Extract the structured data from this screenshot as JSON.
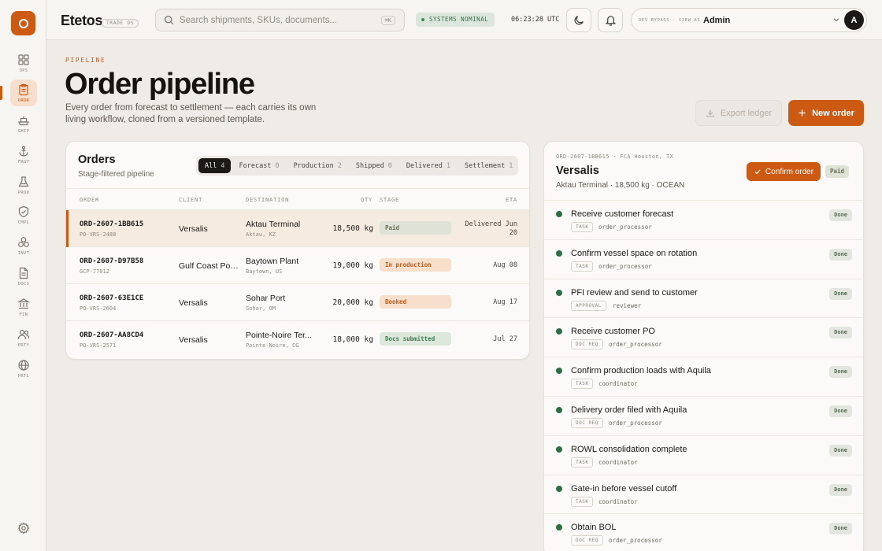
{
  "sidebar": {
    "items": [
      {
        "label": "OPS",
        "icon": "grid-icon"
      },
      {
        "label": "ORDR",
        "icon": "clipboard-icon"
      },
      {
        "label": "SHIP",
        "icon": "ship-icon"
      },
      {
        "label": "FRGT",
        "icon": "anchor-icon"
      },
      {
        "label": "PROD",
        "icon": "flask-icon"
      },
      {
        "label": "CMPL",
        "icon": "shield-check-icon"
      },
      {
        "label": "INVT",
        "icon": "boxes-icon"
      },
      {
        "label": "DOCS",
        "icon": "document-icon"
      },
      {
        "label": "FIN",
        "icon": "bank-icon"
      },
      {
        "label": "PRTY",
        "icon": "users-icon"
      },
      {
        "label": "PRTL",
        "icon": "globe-icon"
      }
    ],
    "active_index": 1
  },
  "header": {
    "brand": "Etetos",
    "brand_badge": "TRADE OS",
    "search_placeholder": "Search shipments, SKUs, documents...",
    "search_shortcut": "⌘K",
    "status": "SYSTEMS NOMINAL",
    "clock": "06:23:28 UTC",
    "user_tag": "DEV BYPASS · VIEW AS",
    "user_name": "Admin",
    "avatar_initial": "A"
  },
  "page": {
    "eyebrow": "PIPELINE",
    "title": "Order pipeline",
    "subtitle": "Every order from forecast to settlement — each carries its own living workflow, cloned from a versioned template.",
    "export_label": "Export ledger",
    "new_label": "New order"
  },
  "orders": {
    "title": "Orders",
    "subtitle": "Stage-filtered pipeline",
    "filters": [
      {
        "label": "All",
        "count": "4"
      },
      {
        "label": "Forecast",
        "count": "0"
      },
      {
        "label": "Production",
        "count": "2"
      },
      {
        "label": "Shipped",
        "count": "0"
      },
      {
        "label": "Delivered",
        "count": "1"
      },
      {
        "label": "Settlement",
        "count": "1"
      }
    ],
    "columns": {
      "order": "ORDER",
      "client": "CLIENT",
      "destination": "DESTINATION",
      "qty": "QTY",
      "stage": "STAGE",
      "eta": "ETA"
    },
    "rows": [
      {
        "order": "ORD-2607-1BB615",
        "po": "PO-VRS-2488",
        "client": "Versalis",
        "dest": "Aktau Terminal",
        "dest_sub": "Aktau, KZ",
        "qty": "18,500 kg",
        "stage": "Paid",
        "eta_1": "Delivered Jun",
        "eta_2": "20"
      },
      {
        "order": "ORD-2607-D97B58",
        "po": "GCP-77012",
        "client": "Gulf Coast Pol...",
        "dest": "Baytown Plant",
        "dest_sub": "Baytown, US",
        "qty": "19,000 kg",
        "stage": "In production",
        "eta": "Aug 08"
      },
      {
        "order": "ORD-2607-63E1CE",
        "po": "PO-VRS-2604",
        "client": "Versalis",
        "dest": "Sohar Port",
        "dest_sub": "Sohar, OM",
        "qty": "20,000 kg",
        "stage": "Booked",
        "eta": "Aug 17"
      },
      {
        "order": "ORD-2607-AA8CD4",
        "po": "PO-VRS-2571",
        "client": "Versalis",
        "dest": "Pointe-Noire Ter...",
        "dest_sub": "Pointe-Noire, CG",
        "qty": "18,000 kg",
        "stage": "Docs submitted",
        "eta": "Jul 27"
      }
    ]
  },
  "detail": {
    "meta": "ORD-2607-1BB615 · FCA Houston, TX",
    "client": "Versalis",
    "subtitle": "Aktau Terminal · 18,500 kg · OCEAN",
    "confirm_label": "Confirm order",
    "status_badge": "Paid",
    "steps": [
      {
        "title": "Receive customer forecast",
        "kind": "TASK",
        "role": "order_processor",
        "status": "Done"
      },
      {
        "title": "Confirm vessel space on rotation",
        "kind": "TASK",
        "role": "order_processor",
        "status": "Done"
      },
      {
        "title": "PFI review and send to customer",
        "kind": "APPROVAL",
        "role": "reviewer",
        "status": "Done"
      },
      {
        "title": "Receive customer PO",
        "kind": "DOC REQ",
        "role": "order_processor",
        "status": "Done"
      },
      {
        "title": "Confirm production loads with Aquila",
        "kind": "TASK",
        "role": "coordinator",
        "status": "Done"
      },
      {
        "title": "Delivery order filed with Aquila",
        "kind": "DOC REQ",
        "role": "order_processor",
        "status": "Done"
      },
      {
        "title": "ROWL consolidation complete",
        "kind": "TASK",
        "role": "coordinator",
        "status": "Done"
      },
      {
        "title": "Gate-in before vessel cutoff",
        "kind": "TASK",
        "role": "coordinator",
        "status": "Done"
      },
      {
        "title": "Obtain BOL",
        "kind": "DOC REQ",
        "role": "order_processor",
        "status": "Done"
      }
    ]
  },
  "colors": {
    "accent": "#cc5a12",
    "done_dot": "#2f6e45",
    "background": "#efebe6"
  }
}
